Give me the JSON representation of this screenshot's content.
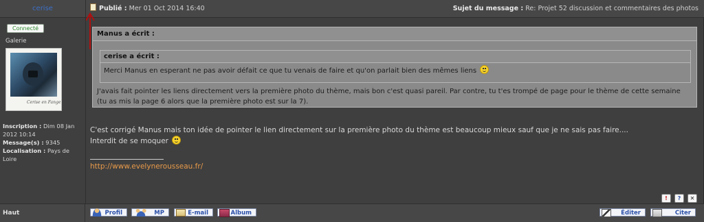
{
  "author": {
    "name": "cerise"
  },
  "post_header": {
    "published_label": "Publié",
    "published_date": "Mer 01 Oct 2014 16:40",
    "subject_label": "Sujet du message",
    "subject": "Re: Projet 52 discussion et commentaires des photos"
  },
  "profile": {
    "status": "Connecté",
    "rank": "Galerie",
    "avatar_caption": "Cerise en Fange",
    "inscription_label": "Inscription :",
    "inscription_value": "Dim 08 Jan 2012 10:14",
    "messages_label": "Message(s) :",
    "messages_value": "9345",
    "location_label": "Localisation :",
    "location_value": "Pays de Loire"
  },
  "message": {
    "outer_quote_author": "Manus a écrit :",
    "inner_quote_author": "cerise a écrit :",
    "inner_quote_text": "Merci Manus en esperant ne pas avoir défait ce que tu venais de faire et qu'on parlait bien des mêmes liens",
    "outer_quote_text": "J'avais fait pointer les liens directement vers la première photo du thème, mais bon c'est quasi pareil. Par contre, tu t'es trompé de page pour le thème de cette semaine (tu as mis la page 6 alors que la première photo est sur la 7).",
    "reply_line1": "C'est corrigé Manus mais ton idée de pointer le lien directement sur la première photo du thème est beaucoup mieux sauf que je ne sais pas faire....",
    "reply_line2": "Interdit de se moquer",
    "signature_link": "http://www.evelynerousseau.fr/"
  },
  "mini_icons": {
    "report": "!",
    "info": "?",
    "delete": "✕"
  },
  "footer": {
    "top_label": "Haut",
    "profile_btn": "Profil",
    "mp_btn": "MP",
    "email_btn": "E-mail",
    "album_btn": "Album",
    "edit_btn": "Éditer",
    "quote_btn": "Citer"
  },
  "icons": {
    "post_icon": "post-icon",
    "smiley": "smiley-icon",
    "arrow": "red-arrow-annotation"
  },
  "colors": {
    "background": "#3f3f3f",
    "header_bg": "#474747",
    "quote_bg": "#8a8a8a",
    "author_color": "#3b6fc7",
    "link_color": "#e89a4a",
    "online_color": "#2e8b2e",
    "arrow_color": "#b01010"
  }
}
